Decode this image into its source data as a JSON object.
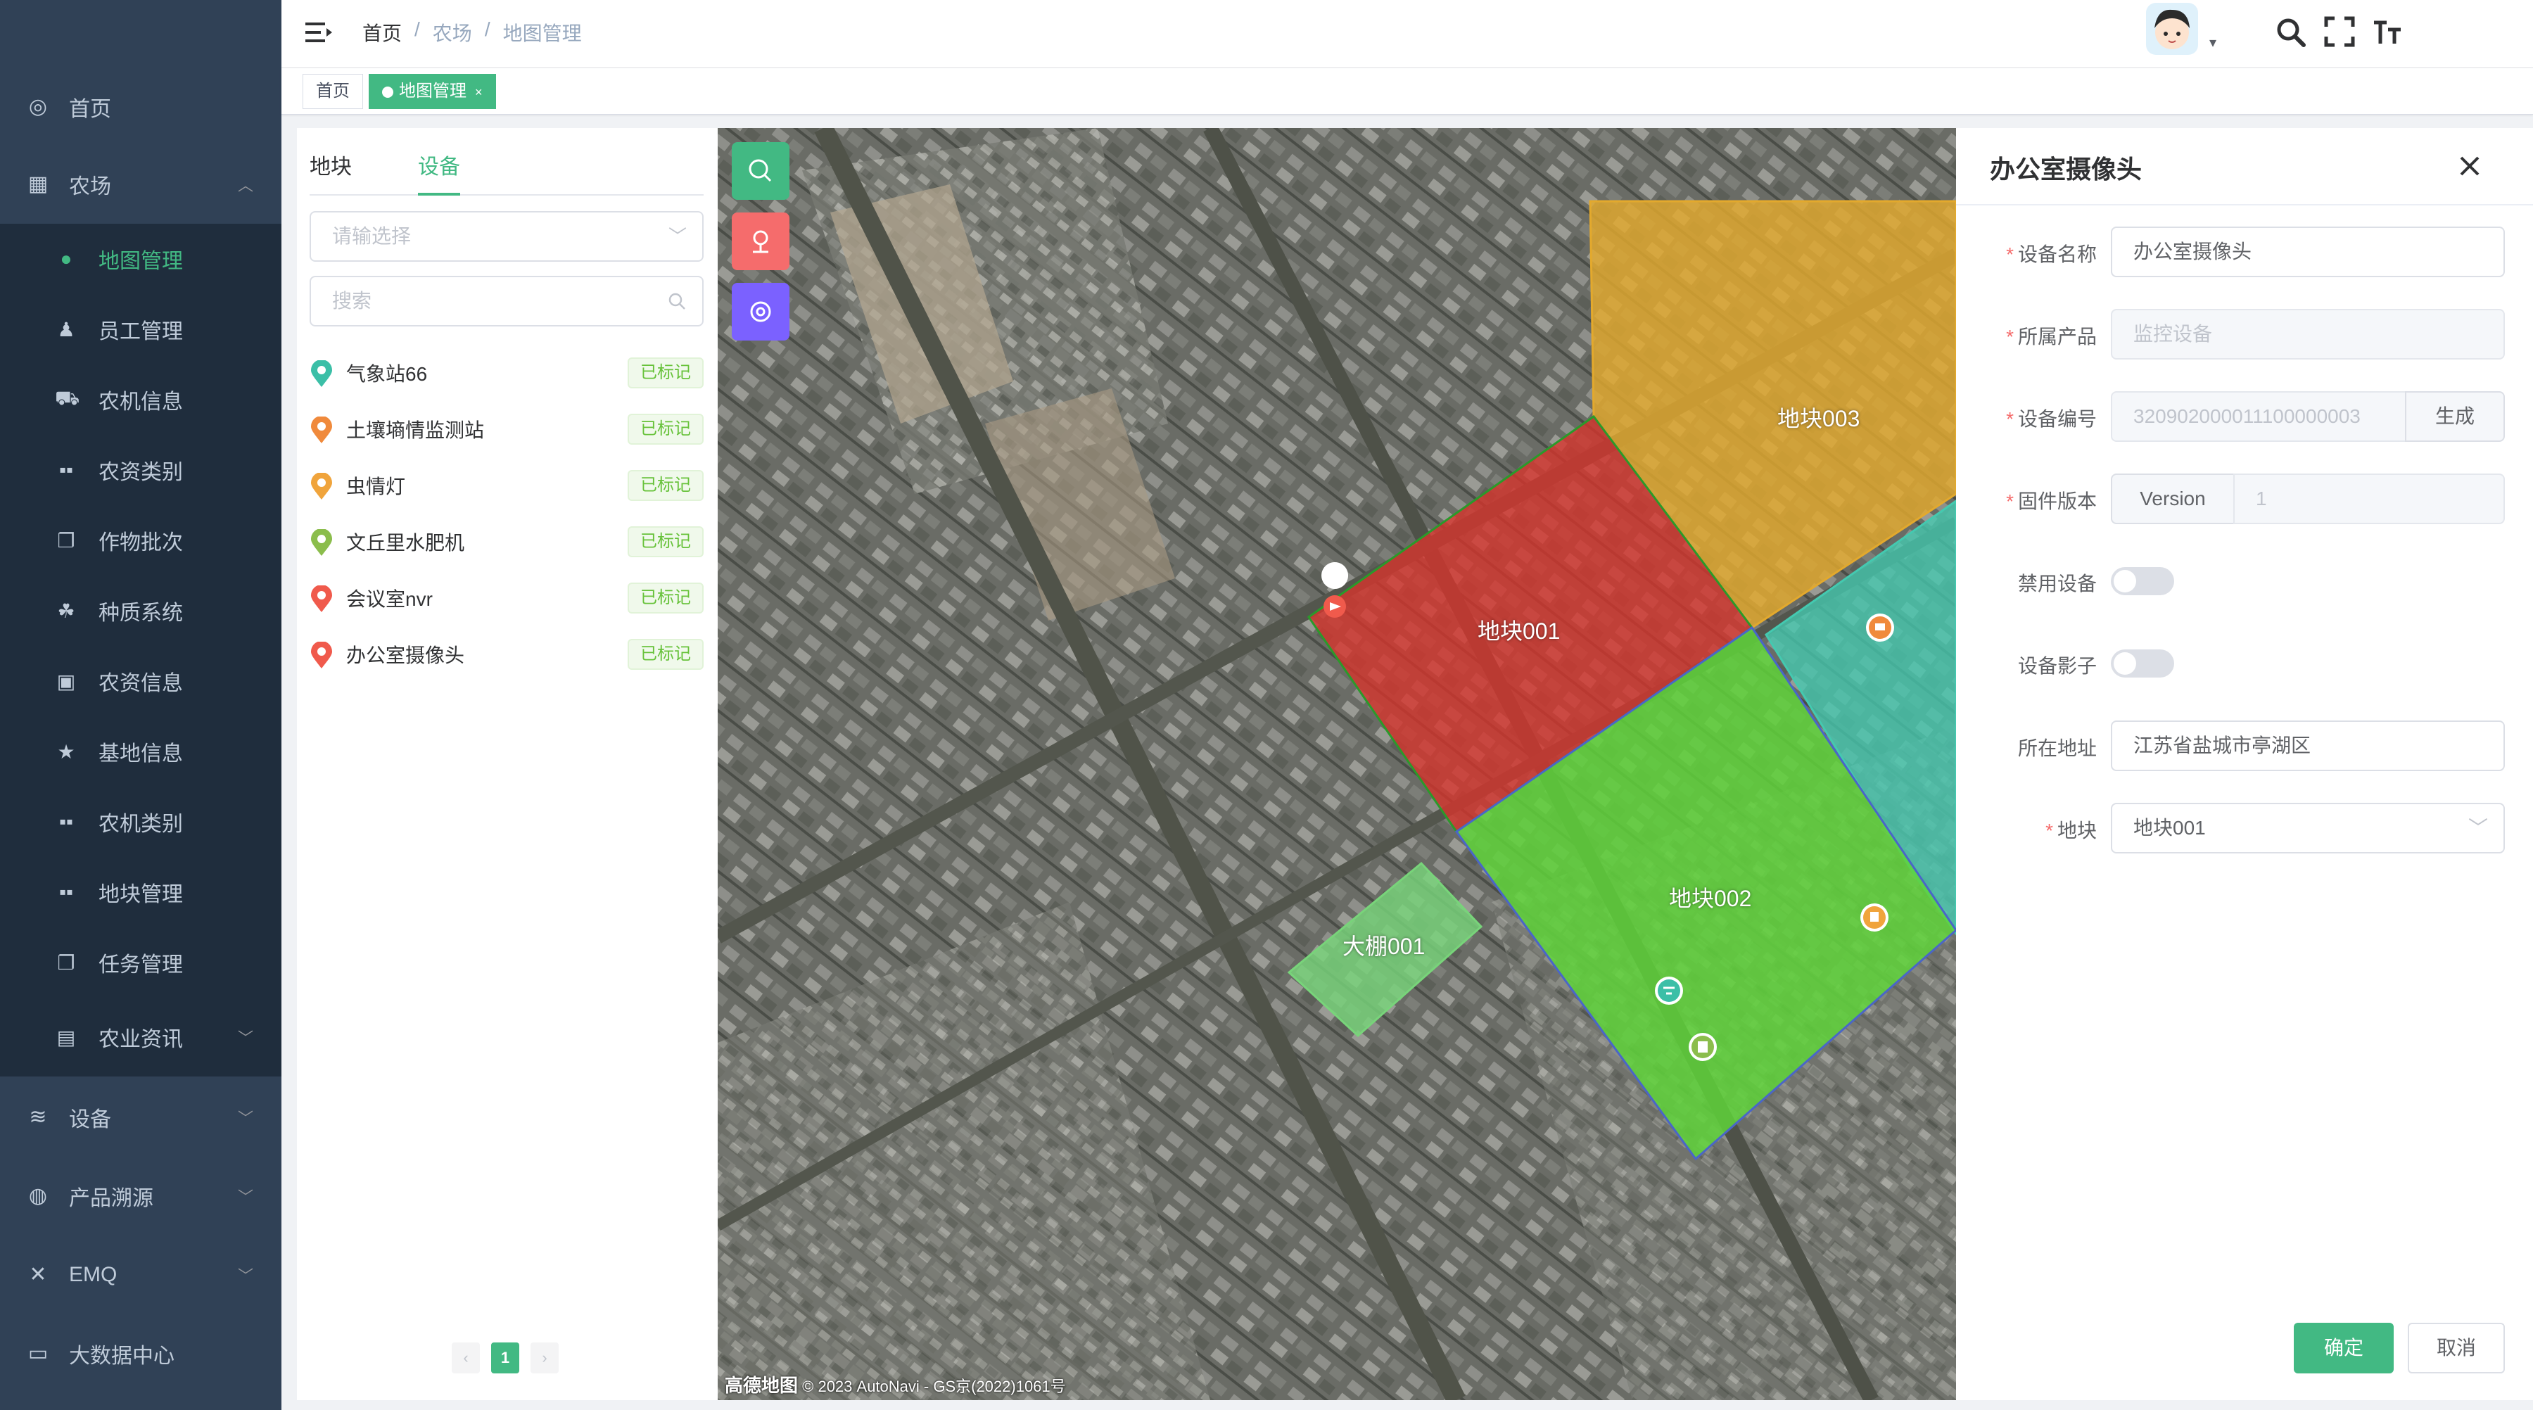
{
  "sidebar": {
    "menu": [
      {
        "label": "首页",
        "icon": "dashboard-icon"
      },
      {
        "label": "农场",
        "icon": "table-icon"
      },
      {
        "label": "农业资讯",
        "icon": "chart-icon"
      },
      {
        "label": "设备",
        "icon": "layers-icon"
      },
      {
        "label": "产品溯源",
        "icon": "globe-icon"
      },
      {
        "label": "EMQ",
        "icon": "tools-icon"
      },
      {
        "label": "大数据中心",
        "icon": "monitor-icon"
      }
    ],
    "farm_items": [
      {
        "label": "地图管理",
        "icon": "globe-icon"
      },
      {
        "label": "员工管理",
        "icon": "user-icon"
      },
      {
        "label": "农机信息",
        "icon": "tractor-icon"
      },
      {
        "label": "农资类别",
        "icon": "grid-icon"
      },
      {
        "label": "作物批次",
        "icon": "copy-icon"
      },
      {
        "label": "种质系统",
        "icon": "seed-icon"
      },
      {
        "label": "农资信息",
        "icon": "box-icon"
      },
      {
        "label": "基地信息",
        "icon": "star-icon"
      },
      {
        "label": "农机类别",
        "icon": "grid-icon"
      },
      {
        "label": "地块管理",
        "icon": "grid-icon"
      },
      {
        "label": "任务管理",
        "icon": "copy-icon"
      }
    ]
  },
  "navbar": {
    "breadcrumb": [
      "首页",
      "农场",
      "地图管理"
    ]
  },
  "tagsview": {
    "tags": [
      {
        "label": "首页"
      },
      {
        "label": "地图管理"
      }
    ]
  },
  "left_panel": {
    "tabs": [
      "地块",
      "设备"
    ],
    "select_placeholder": "请输选择",
    "search_placeholder": "搜索",
    "devices": [
      {
        "name": "气象站66",
        "status": "已标记",
        "color": "#3bbfa7"
      },
      {
        "name": "土壤墒情监测站",
        "status": "已标记",
        "color": "#f08a3c"
      },
      {
        "name": "虫情灯",
        "status": "已标记",
        "color": "#f0a43c"
      },
      {
        "name": "文丘里水肥机",
        "status": "已标记",
        "color": "#8bbd4c"
      },
      {
        "name": "会议室nvr",
        "status": "已标记",
        "color": "#f05a4c"
      },
      {
        "name": "办公室摄像头",
        "status": "已标记",
        "color": "#f05a4c"
      }
    ],
    "pager": {
      "current": "1"
    }
  },
  "map": {
    "plots": [
      {
        "name": "地块003",
        "color": "#e3a92d"
      },
      {
        "name": "地块001",
        "color": "#d9332b"
      },
      {
        "name": "地块002",
        "color": "#5fd43a"
      },
      {
        "name": "大棚001",
        "color": "#78d47a"
      }
    ],
    "copyright_logo": "高德地图",
    "copyright_text": "© 2023 AutoNavi - GS京(2022)1061号"
  },
  "drawer": {
    "title": "办公室摄像头",
    "fields": {
      "device_name": {
        "label": "设备名称",
        "value": "办公室摄像头"
      },
      "product": {
        "label": "所属产品",
        "value": "监控设备"
      },
      "device_no": {
        "label": "设备编号",
        "value": "320902000011100000003",
        "button": "生成"
      },
      "firmware": {
        "label": "固件版本",
        "prefix": "Version",
        "value": "1"
      },
      "disable": {
        "label": "禁用设备"
      },
      "shadow": {
        "label": "设备影子"
      },
      "address": {
        "label": "所在地址",
        "value": "江苏省盐城市亭湖区"
      },
      "plot": {
        "label": "地块",
        "value": "地块001"
      }
    },
    "ok_label": "确定",
    "cancel_label": "取消"
  },
  "colors": {
    "accent": "#42b983",
    "sidebar_bg": "#304156",
    "submenu_bg": "#1f2d3d"
  }
}
